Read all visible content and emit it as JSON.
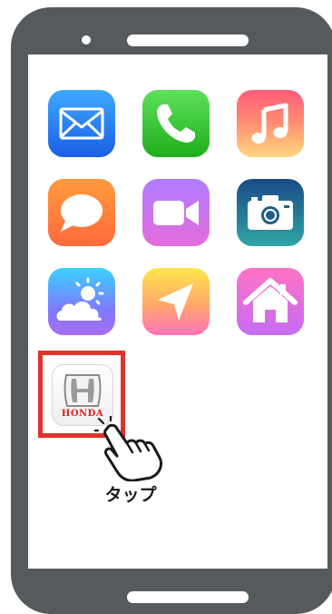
{
  "device": {
    "type": "smartphone",
    "frame_color": "#555a5d"
  },
  "apps": [
    {
      "name": "mail",
      "icon": "envelope-icon"
    },
    {
      "name": "phone",
      "icon": "phone-handset-icon"
    },
    {
      "name": "music",
      "icon": "music-note-icon"
    },
    {
      "name": "messages",
      "icon": "speech-bubble-icon"
    },
    {
      "name": "facetime",
      "icon": "video-camera-icon"
    },
    {
      "name": "camera",
      "icon": "camera-icon"
    },
    {
      "name": "weather",
      "icon": "sun-cloud-icon"
    },
    {
      "name": "maps",
      "icon": "navigation-arrow-icon"
    },
    {
      "name": "home",
      "icon": "house-icon"
    }
  ],
  "honda_app": {
    "logo_text": "HONDA",
    "icon": "honda-logo-icon",
    "highlight_color": "#e0322b"
  },
  "gesture": {
    "icon": "tapping-hand-icon",
    "label": "タップ"
  }
}
